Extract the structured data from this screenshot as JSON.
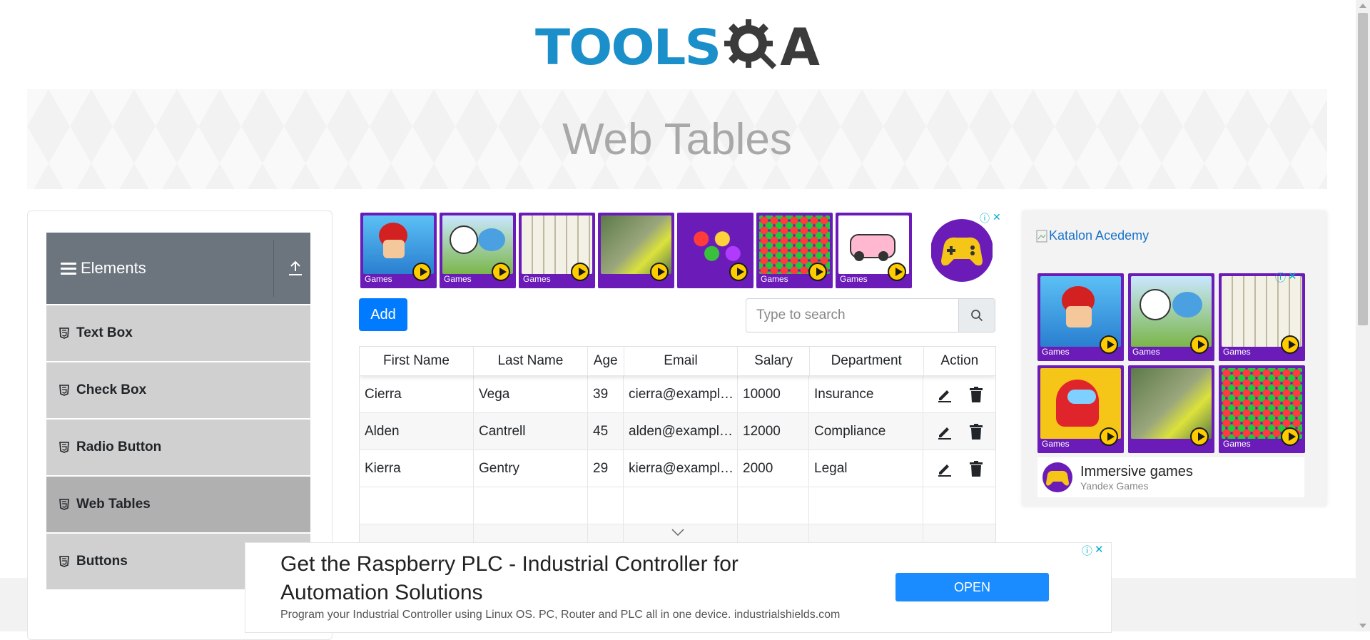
{
  "logo": {
    "text": "TOOLS",
    "suffix": "A"
  },
  "banner": {
    "title": "Web Tables"
  },
  "sidebar": {
    "group_title": "Elements",
    "items": [
      {
        "label": "Text Box"
      },
      {
        "label": "Check Box"
      },
      {
        "label": "Radio Button"
      },
      {
        "label": "Web Tables"
      },
      {
        "label": "Buttons"
      }
    ]
  },
  "top_ad": {
    "tile_tag": "Games"
  },
  "controls": {
    "add_label": "Add",
    "search_placeholder": "Type to search"
  },
  "table": {
    "headers": [
      "First Name",
      "Last Name",
      "Age",
      "Email",
      "Salary",
      "Department",
      "Action"
    ],
    "rows": [
      [
        "Cierra",
        "Vega",
        "39",
        "cierra@example.com",
        "10000",
        "Insurance"
      ],
      [
        "Alden",
        "Cantrell",
        "45",
        "alden@example.com",
        "12000",
        "Compliance"
      ],
      [
        "Kierra",
        "Gentry",
        "29",
        "kierra@example.com",
        "2000",
        "Legal"
      ]
    ]
  },
  "right_ad": {
    "katalon_alt": "Katalon Acedemy",
    "tile_tag": "Games",
    "footer_title": "Immersive games",
    "footer_sub": "Yandex Games"
  },
  "bottom_ad": {
    "title": "Get the Raspberry PLC - Industrial Controller for Automation Solutions",
    "desc": "Program your Industrial Controller using Linux OS. PC, Router and PLC all in one device. industrialshields.com",
    "open_label": "OPEN"
  },
  "colors": {
    "primary": "#007bff",
    "sidebar_header": "#6c757d",
    "menu_item": "#d0d0d0",
    "menu_active": "#b0b0b0",
    "ad_purple": "#6a1bb8",
    "logo_blue": "#1b8fc9"
  }
}
